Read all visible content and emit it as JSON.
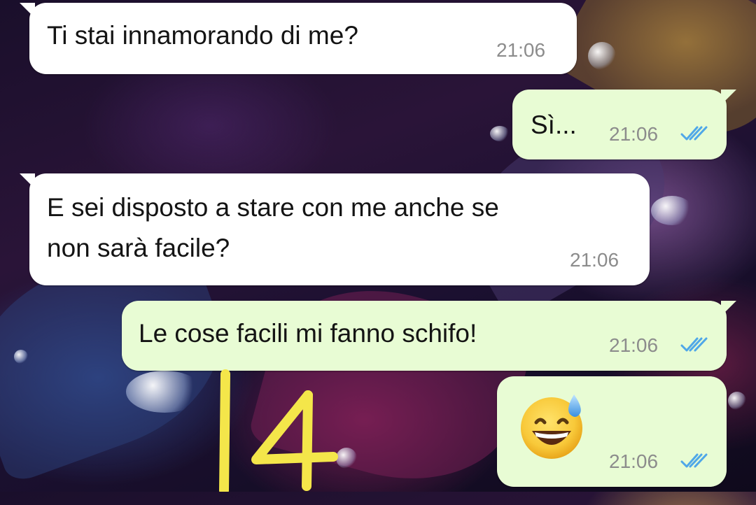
{
  "chat": {
    "messages": [
      {
        "direction": "incoming",
        "text": "Ti stai innamorando di me?",
        "time": "21:06"
      },
      {
        "direction": "outgoing",
        "text": "Sì...",
        "time": "21:06",
        "status": "read-double-check"
      },
      {
        "direction": "incoming",
        "text_line1": "E sei disposto a stare con me anche se",
        "text_line2": "non sarà facile?",
        "time": "21:06"
      },
      {
        "direction": "outgoing",
        "text": "Le cose facili mi fanno schifo!",
        "time": "21:06",
        "status": "read-double-check"
      },
      {
        "direction": "outgoing",
        "emoji": "grinning-face-with-sweat",
        "time": "21:06",
        "status": "read-double-check"
      }
    ]
  },
  "overlay": {
    "sticker_text": "14",
    "sticker_color": "#f4e64a"
  },
  "colors": {
    "incoming_bubble": "#ffffff",
    "outgoing_bubble": "#e8fcd4",
    "read_ticks": "#4fa7e8",
    "timestamp": "#8c8c8c"
  }
}
